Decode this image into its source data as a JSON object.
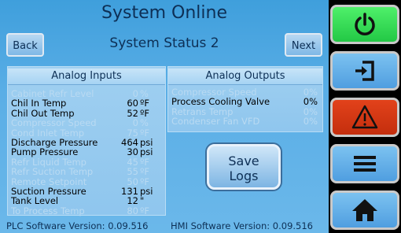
{
  "header": {
    "title": "System Online",
    "subtitle": "System Status 2"
  },
  "nav": {
    "back": "Back",
    "next": "Next"
  },
  "analog_inputs": {
    "title": "Analog Inputs",
    "rows": [
      {
        "label": "Cabinet Refr Level",
        "value": "0",
        "unit": "%",
        "active": false
      },
      {
        "label": "Chil In Temp",
        "value": "60",
        "unit": "ºF",
        "active": true
      },
      {
        "label": "Chil Out Temp",
        "value": "52",
        "unit": "ºF",
        "active": true
      },
      {
        "label": "Compressor Speed",
        "value": "0",
        "unit": "%",
        "active": false
      },
      {
        "label": "Cond Inlet Temp",
        "value": "75",
        "unit": "ºF",
        "active": false
      },
      {
        "label": "Discharge Pressure",
        "value": "464",
        "unit": "psi",
        "active": true
      },
      {
        "label": "Pump Pressure",
        "value": "30",
        "unit": "psi",
        "active": true
      },
      {
        "label": "Refr Liquid Temp",
        "value": "45",
        "unit": "ºF",
        "active": false
      },
      {
        "label": "Refr Suction Temp",
        "value": "55",
        "unit": "ºF",
        "active": false
      },
      {
        "label": "Remote Setpoint",
        "value": "50",
        "unit": "ºF",
        "active": false
      },
      {
        "label": "Suction Pressure",
        "value": "131",
        "unit": "psi",
        "active": true
      },
      {
        "label": "Tank Level",
        "value": "12",
        "unit": "\"",
        "active": true
      },
      {
        "label": "To Process Temp",
        "value": "80",
        "unit": "ºF",
        "active": false
      }
    ]
  },
  "analog_outputs": {
    "title": "Analog Outputs",
    "rows": [
      {
        "label": "Compressor Speed",
        "value": "0%",
        "active": false
      },
      {
        "label": "Process Cooling Valve",
        "value": "0%",
        "active": true
      },
      {
        "label": "Retrans Temp",
        "value": "0%",
        "active": false
      },
      {
        "label": "Condenser Fan VFD",
        "value": "0%",
        "active": false
      }
    ]
  },
  "save_button": {
    "line1": "Save",
    "line2": "Logs"
  },
  "footer": {
    "plc": "PLC Software Version:  0.09.516",
    "hmi": "HMI Software Version:  0.09.516"
  },
  "side_buttons": [
    {
      "icon": "power-icon",
      "color": "#33d656"
    },
    {
      "icon": "login-icon",
      "color": "#5aa8e4"
    },
    {
      "icon": "warning-icon",
      "color": "#d43a15"
    },
    {
      "icon": "menu-icon",
      "color": "#5aa8e4"
    },
    {
      "icon": "home-icon",
      "color": "#5aa8e4"
    }
  ]
}
